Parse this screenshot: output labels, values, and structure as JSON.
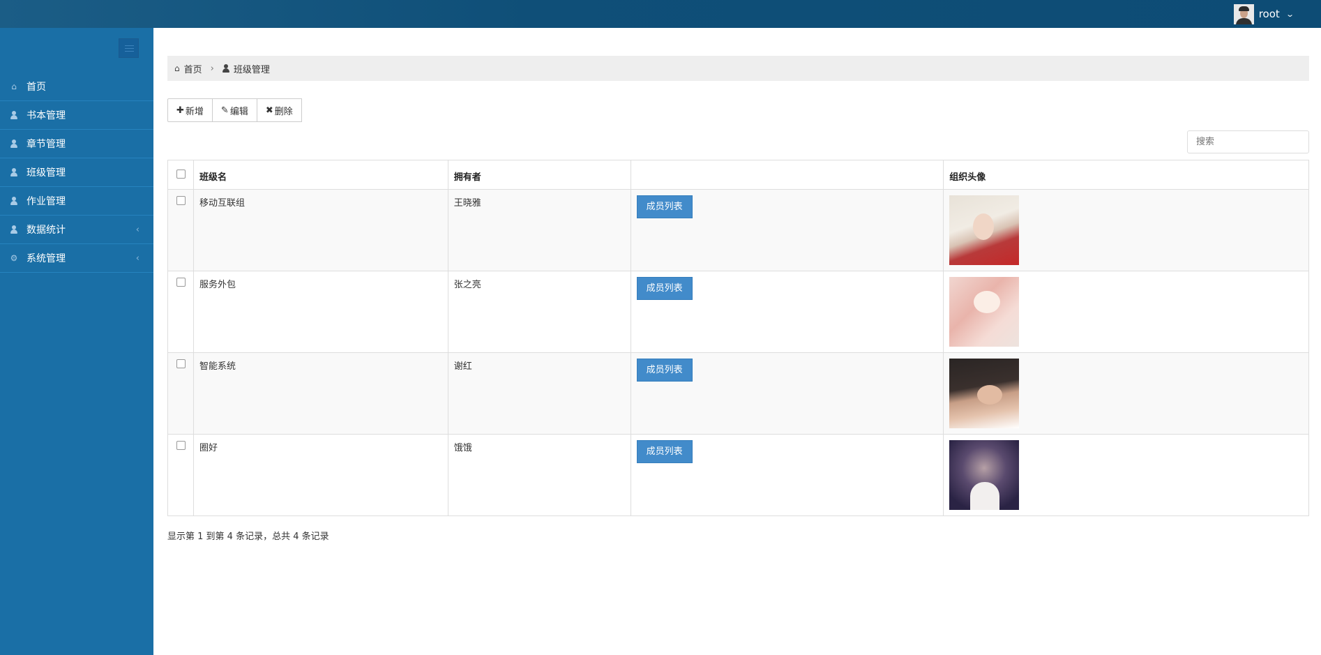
{
  "header": {
    "username": "root",
    "avatar_icon": "user-avatar",
    "dropdown_icon": "chevron-down-icon"
  },
  "sidebar": {
    "toggle_icon": "menu-toggle-icon",
    "items": [
      {
        "label": "首页",
        "icon": "home-icon",
        "has_arrow": false
      },
      {
        "label": "书本管理",
        "icon": "user-icon",
        "has_arrow": false
      },
      {
        "label": "章节管理",
        "icon": "user-icon",
        "has_arrow": false
      },
      {
        "label": "班级管理",
        "icon": "user-icon",
        "has_arrow": false
      },
      {
        "label": "作业管理",
        "icon": "user-icon",
        "has_arrow": false
      },
      {
        "label": "数据统计",
        "icon": "user-icon",
        "has_arrow": true
      },
      {
        "label": "系统管理",
        "icon": "cogs-icon",
        "has_arrow": true
      }
    ]
  },
  "breadcrumb": {
    "home": "首页",
    "current": "班级管理"
  },
  "toolbar": {
    "add_label": "新增",
    "edit_label": "编辑",
    "delete_label": "删除"
  },
  "search": {
    "placeholder": "搜索"
  },
  "table": {
    "headers": [
      "班级名",
      "拥有者",
      "",
      "组织头像"
    ],
    "member_button_label": "成员列表",
    "rows": [
      {
        "name": "移动互联组",
        "owner": "王晓雅"
      },
      {
        "name": "服务外包",
        "owner": "张之亮"
      },
      {
        "name": "智能系统",
        "owner": "谢红"
      },
      {
        "name": "圈好",
        "owner": "饿饿"
      }
    ]
  },
  "pagination": {
    "info": "显示第 1 到第 4 条记录，总共 4 条记录"
  }
}
